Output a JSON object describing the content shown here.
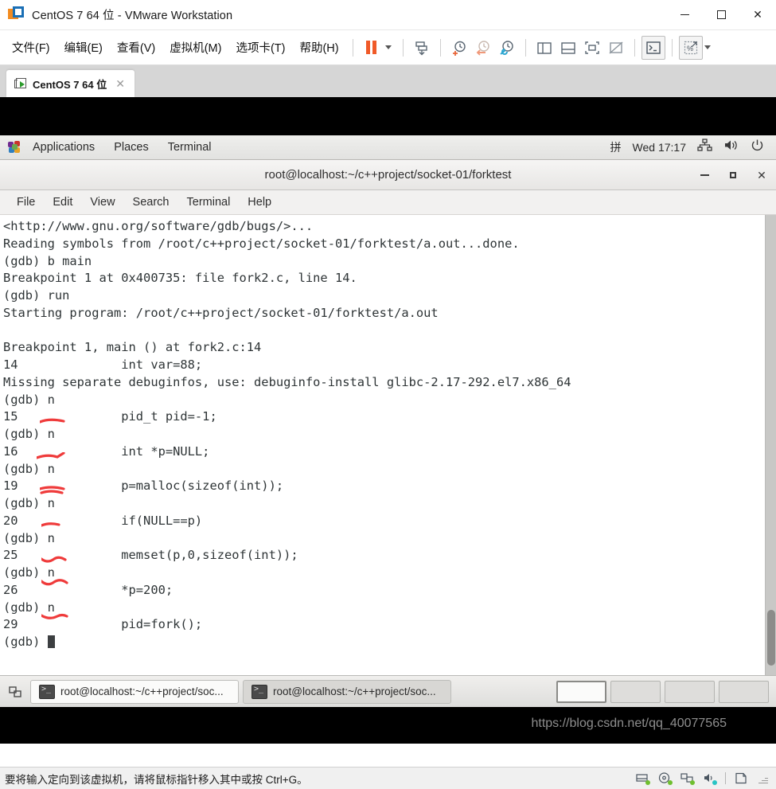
{
  "window": {
    "title": "CentOS 7 64 位 - VMware Workstation",
    "logo_icon": "vmware-logo-icon",
    "minimize_label": "minimize",
    "maximize_label": "maximize",
    "close_label": "✕"
  },
  "menubar": {
    "items": [
      {
        "label": "文件(F)",
        "name": "menu-file"
      },
      {
        "label": "编辑(E)",
        "name": "menu-edit"
      },
      {
        "label": "查看(V)",
        "name": "menu-view"
      },
      {
        "label": "虚拟机(M)",
        "name": "menu-vm"
      },
      {
        "label": "选项卡(T)",
        "name": "menu-tabs"
      },
      {
        "label": "帮助(H)",
        "name": "menu-help"
      }
    ]
  },
  "toolbar": {
    "icons": [
      {
        "name": "suspend-icon",
        "title": "挂起"
      },
      {
        "name": "power-dropdown-icon",
        "title": "电源选项"
      },
      {
        "name": "send-ctrl-alt-del-icon",
        "title": "发送组合键"
      },
      {
        "name": "take-snapshot-icon",
        "title": "拍摄快照"
      },
      {
        "name": "revert-snapshot-icon",
        "title": "恢复快照"
      },
      {
        "name": "snapshot-manager-icon",
        "title": "快照管理器"
      },
      {
        "name": "show-library-icon",
        "title": "显示库"
      },
      {
        "name": "show-thumbnail-bar-icon",
        "title": "显示缩略图栏"
      },
      {
        "name": "full-screen-icon",
        "title": "全屏"
      },
      {
        "name": "unity-mode-icon",
        "title": "Unity 模式"
      },
      {
        "name": "console-view-icon",
        "title": "控制台视图"
      },
      {
        "name": "stretch-guest-icon",
        "title": "拉伸客户机"
      },
      {
        "name": "stretch-dropdown-icon",
        "title": "更多"
      }
    ]
  },
  "tabstrip": {
    "tabs": [
      {
        "label": "CentOS 7 64 位",
        "icon": "vm-tab-icon",
        "close": "✕",
        "active": true
      }
    ]
  },
  "guest": {
    "gnome_panel": {
      "applications": "Applications",
      "places": "Places",
      "terminal": "Terminal",
      "input_method": "拼",
      "clock": "Wed 17:17",
      "network_icon": "network-icon",
      "volume_icon": "volume-icon",
      "power_icon": "power-icon"
    },
    "terminal_window": {
      "title": "root@localhost:~/c++project/socket-01/forktest",
      "minimize": "minimize",
      "maximize": "maximize",
      "close": "✕",
      "menus": [
        "File",
        "Edit",
        "View",
        "Search",
        "Terminal",
        "Help"
      ],
      "lines": [
        "<http://www.gnu.org/software/gdb/bugs/>...",
        "Reading symbols from /root/c++project/socket-01/forktest/a.out...done.",
        "(gdb) b main",
        "Breakpoint 1 at 0x400735: file fork2.c, line 14.",
        "(gdb) run",
        "Starting program: /root/c++project/socket-01/forktest/a.out",
        "",
        "Breakpoint 1, main () at fork2.c:14",
        "14              int var=88;",
        "Missing separate debuginfos, use: debuginfo-install glibc-2.17-292.el7.x86_64",
        "(gdb) n",
        "15              pid_t pid=-1;",
        "(gdb) n",
        "16              int *p=NULL;",
        "(gdb) n",
        "19              p=malloc(sizeof(int));",
        "(gdb) n",
        "20              if(NULL==p)",
        "(gdb) n",
        "25              memset(p,0,sizeof(int));",
        "(gdb) n",
        "26              *p=200;",
        "(gdb) n",
        "29              pid=fork();",
        "(gdb) "
      ],
      "cursor": "block-cursor",
      "annotations": [
        {
          "name": "red-pen-mark-line-15"
        },
        {
          "name": "red-pen-mark-line-16"
        },
        {
          "name": "red-pen-mark-line-19"
        },
        {
          "name": "red-pen-mark-line-20"
        },
        {
          "name": "red-pen-mark-line-25"
        },
        {
          "name": "red-pen-mark-line-26"
        },
        {
          "name": "red-pen-mark-line-29"
        }
      ],
      "annotation_color": "#ef3b3b"
    },
    "taskbar": {
      "show_desktop_icon": "show-desktop-icon",
      "windows": [
        {
          "label": "root@localhost:~/c++project/soc...",
          "icon": "terminal-icon",
          "active": false
        },
        {
          "label": "root@localhost:~/c++project/soc...",
          "icon": "terminal-icon",
          "active": true
        }
      ],
      "workspaces": [
        {
          "name": "workspace-1",
          "active": true
        },
        {
          "name": "workspace-2",
          "active": false
        },
        {
          "name": "workspace-3",
          "active": false
        },
        {
          "name": "workspace-4",
          "active": false
        }
      ]
    }
  },
  "statusbar": {
    "hint": "要将输入定向到该虚拟机，请将鼠标指针移入其中或按 Ctrl+G。",
    "watermark": "https://blog.csdn.net/qq_40077565",
    "icons": [
      {
        "name": "hard-disk-icon",
        "color": "#6fbf2f"
      },
      {
        "name": "cd-dvd-icon",
        "color": "#6fbf2f"
      },
      {
        "name": "network-adapter-icon",
        "color": "#6fbf2f"
      },
      {
        "name": "sound-card-icon",
        "color": "#28c4c4"
      },
      {
        "name": "printer-icon",
        "color": ""
      }
    ]
  },
  "colors": {
    "vmware_orange": "#f05a28",
    "vmware_blue": "#1a6fb5",
    "annotation_red": "#ef3b3b",
    "terminal_fg": "#2e3436"
  }
}
